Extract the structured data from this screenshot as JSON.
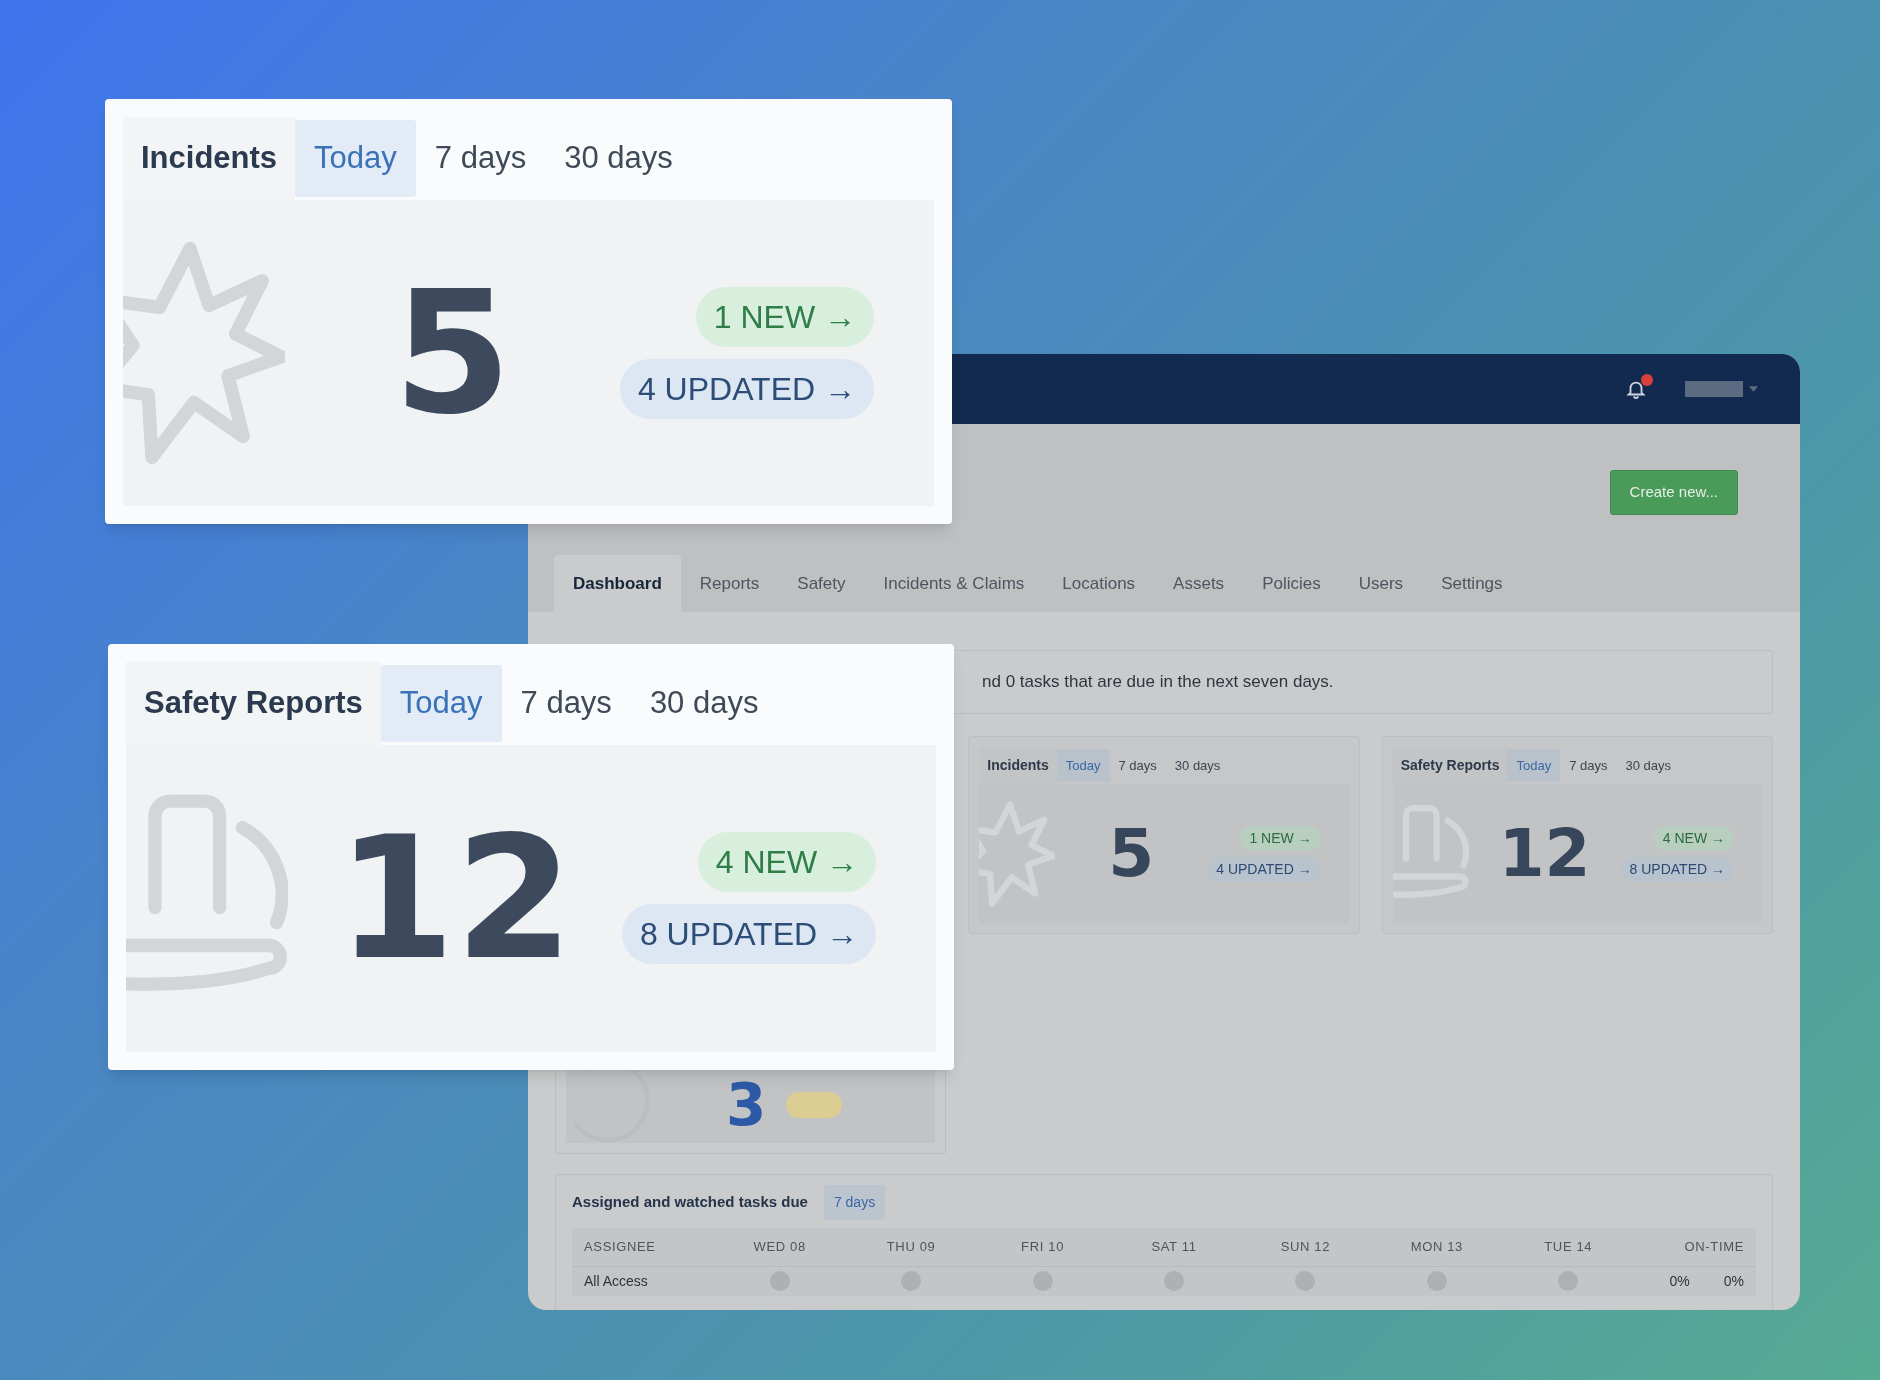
{
  "overlay_cards": [
    {
      "title": "Incidents",
      "kind": "star",
      "count": "5",
      "tabs": [
        {
          "label": "Today",
          "selected": true
        },
        {
          "label": "7 days",
          "selected": false
        },
        {
          "label": "30 days",
          "selected": false
        }
      ],
      "badges": [
        {
          "kind": "new",
          "label": "1 NEW →"
        },
        {
          "kind": "updated",
          "label": "4 UPDATED →"
        }
      ]
    },
    {
      "title": "Safety Reports",
      "kind": "hardhat",
      "count": "12",
      "tabs": [
        {
          "label": "Today",
          "selected": true
        },
        {
          "label": "7 days",
          "selected": false
        },
        {
          "label": "30 days",
          "selected": false
        }
      ],
      "badges": [
        {
          "kind": "new",
          "label": "4 NEW →"
        },
        {
          "kind": "updated",
          "label": "8 UPDATED →"
        }
      ]
    }
  ],
  "app": {
    "notification_alert": true,
    "create_button": "Create new...",
    "nav_tabs": [
      {
        "label": "Dashboard",
        "selected": true
      },
      {
        "label": "Reports",
        "selected": false
      },
      {
        "label": "Safety",
        "selected": false
      },
      {
        "label": "Incidents & Claims",
        "selected": false
      },
      {
        "label": "Locations",
        "selected": false
      },
      {
        "label": "Assets",
        "selected": false
      },
      {
        "label": "Policies",
        "selected": false
      },
      {
        "label": "Users",
        "selected": false
      },
      {
        "label": "Settings",
        "selected": false
      }
    ],
    "banner": "nd 0 tasks that are due in the next seven days.",
    "partial_card": {
      "kind": "ring",
      "count": "3",
      "badges": [
        {
          "kind": "pending"
        }
      ]
    },
    "cards": [
      {
        "title": "Incidents",
        "kind": "star",
        "count": "5",
        "tabs": [
          {
            "label": "Today",
            "selected": true
          },
          {
            "label": "7 days",
            "selected": false
          },
          {
            "label": "30 days",
            "selected": false
          }
        ],
        "badges": [
          {
            "kind": "new",
            "label": "1 NEW →"
          },
          {
            "kind": "updated",
            "label": "4 UPDATED →"
          }
        ]
      },
      {
        "title": "Safety Reports",
        "kind": "hardhat",
        "count": "12",
        "tabs": [
          {
            "label": "Today",
            "selected": true
          },
          {
            "label": "7 days",
            "selected": false
          },
          {
            "label": "30 days",
            "selected": false
          }
        ],
        "badges": [
          {
            "kind": "new",
            "label": "4 NEW →"
          },
          {
            "kind": "updated",
            "label": "8 UPDATED →"
          }
        ]
      }
    ],
    "tasks": {
      "title": "Assigned and watched tasks due",
      "tabs": [
        {
          "label": "7 days",
          "selected": true
        }
      ],
      "columns": [
        "ASSIGNEE",
        "WED 08",
        "THU 09",
        "FRI 10",
        "SAT 11",
        "SUN 12",
        "MON 13",
        "TUE 14",
        "ON-TIME"
      ],
      "rows": [
        {
          "assignee": "All Access",
          "values": [
            "0%",
            "0%"
          ]
        }
      ]
    }
  }
}
